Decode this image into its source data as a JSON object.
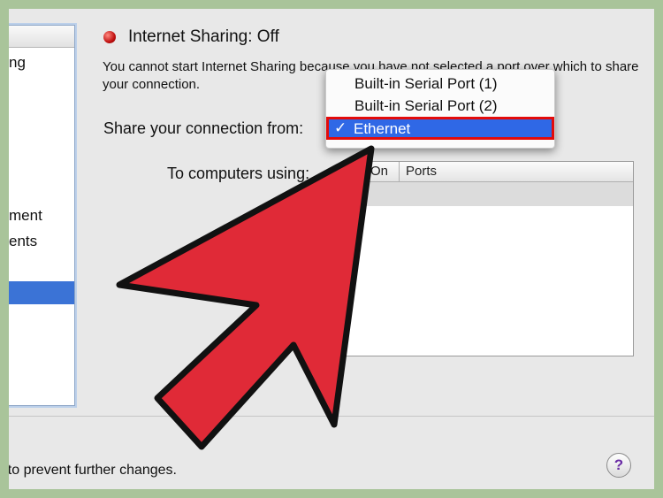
{
  "sidebar": {
    "items": [
      {
        "label": "ng"
      },
      {
        "label": "ment"
      },
      {
        "label": "ents"
      }
    ]
  },
  "internet_sharing": {
    "status": "Internet Sharing: Off",
    "description": "You cannot start Internet Sharing because you have not selected a port over which to share your connection."
  },
  "share_from": {
    "label": "Share your connection from:",
    "options": [
      {
        "label": "Built-in Serial Port (1)"
      },
      {
        "label": "Built-in Serial Port (2)"
      },
      {
        "label": "Ethernet",
        "selected": true
      }
    ],
    "check_glyph": "✓"
  },
  "to_computers": {
    "label": "To computers using:",
    "columns": [
      "On",
      "Ports"
    ]
  },
  "footer": {
    "lock_text": "Click the lock to prevent further changes.",
    "help_glyph": "?"
  },
  "colors": {
    "frame": "#a9c49a",
    "highlight": "#2f68e6",
    "callout_arrow": "#e02a37",
    "callout_box": "#e30b0b"
  }
}
